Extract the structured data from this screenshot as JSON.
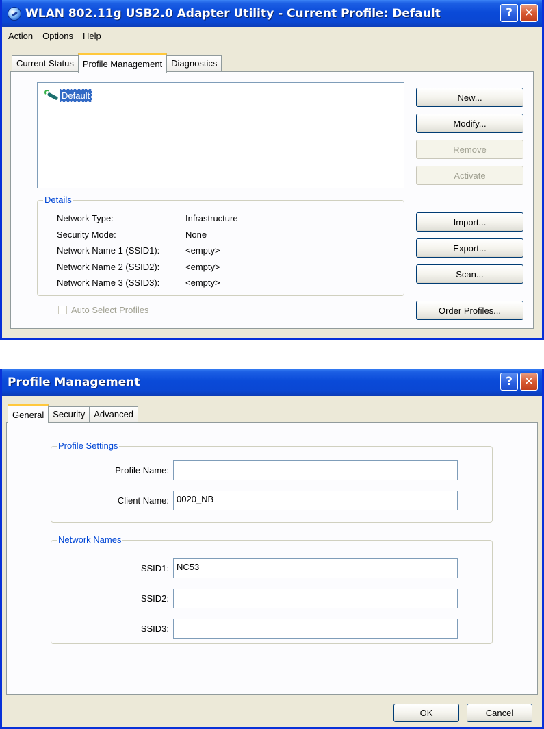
{
  "window1": {
    "title": "WLAN 802.11g USB2.0 Adapter Utility - Current Profile: Default",
    "help_glyph": "?",
    "close_glyph": "✕",
    "menu": [
      "Action",
      "Options",
      "Help"
    ],
    "tabs": [
      "Current Status",
      "Profile Management",
      "Diagnostics"
    ],
    "active_tab": "Profile Management",
    "profiles": [
      "Default"
    ],
    "details_legend": "Details",
    "details": [
      {
        "label": "Network Type:",
        "value": "Infrastructure"
      },
      {
        "label": "Security Mode:",
        "value": "None"
      },
      {
        "label": "Network Name 1 (SSID1):",
        "value": "<empty>"
      },
      {
        "label": "Network Name 2 (SSID2):",
        "value": "<empty>"
      },
      {
        "label": "Network Name 3 (SSID3):",
        "value": "<empty>"
      }
    ],
    "auto_select_label": "Auto Select Profiles",
    "auto_select_checked": false,
    "buttons": {
      "new": "New...",
      "modify": "Modify...",
      "remove": "Remove",
      "activate": "Activate",
      "import": "Import...",
      "export": "Export...",
      "scan": "Scan...",
      "order": "Order Profiles..."
    }
  },
  "window2": {
    "title": "Profile Management",
    "help_glyph": "?",
    "close_glyph": "✕",
    "tabs": [
      "General",
      "Security",
      "Advanced"
    ],
    "active_tab": "General",
    "profile_settings": {
      "legend": "Profile Settings",
      "profile_name_label": "Profile Name:",
      "profile_name_value": "",
      "client_name_label": "Client Name:",
      "client_name_value": "0020_NB"
    },
    "network_names": {
      "legend": "Network Names",
      "ssid1_label": "SSID1:",
      "ssid1_value": "NC53",
      "ssid2_label": "SSID2:",
      "ssid2_value": "",
      "ssid3_label": "SSID3:",
      "ssid3_value": ""
    },
    "ok_label": "OK",
    "cancel_label": "Cancel"
  },
  "colors": {
    "titlebar_blue": "#0a47d3",
    "face": "#ece9d8",
    "selection": "#316ac5",
    "group_legend": "#0046d5",
    "tab_highlight": "#ffc83c"
  }
}
